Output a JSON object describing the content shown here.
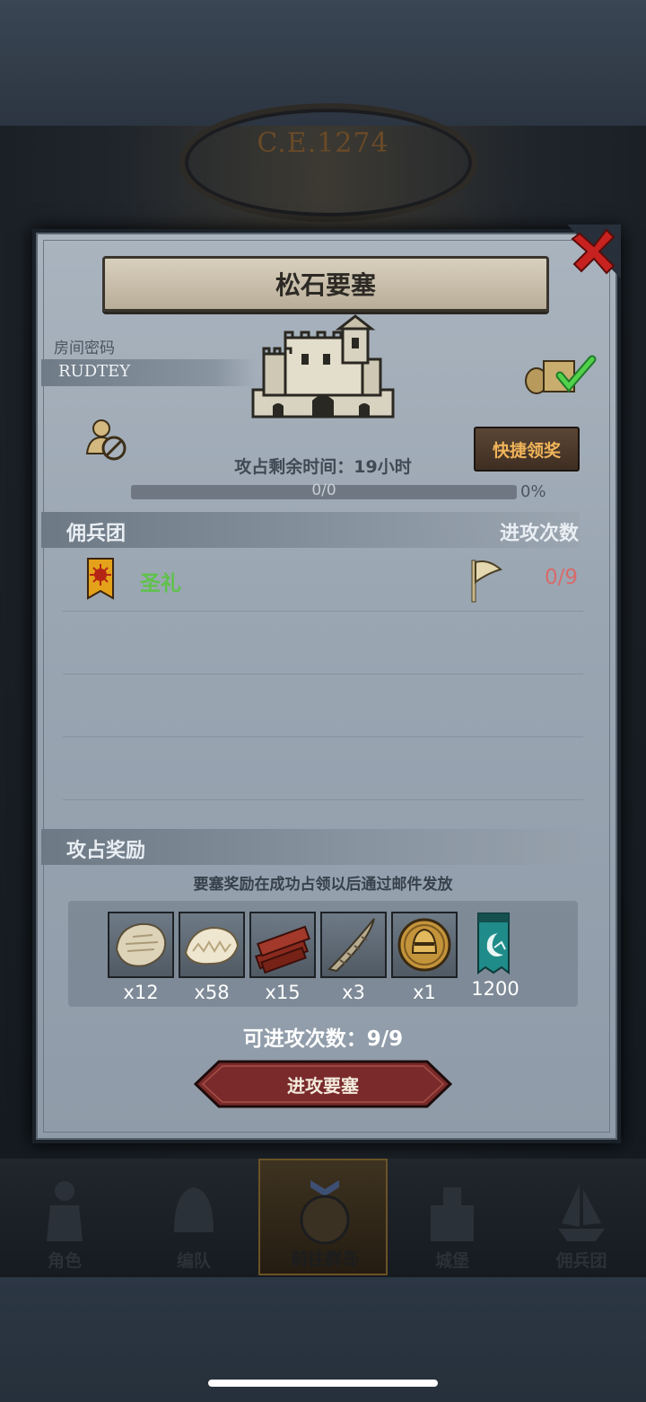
{
  "background": {
    "year_label": "C.E.1274"
  },
  "panel": {
    "title": "松石要塞",
    "room_label": "房间密码",
    "room_code": "RUDTEY",
    "quick_claim_label": "快捷领奖",
    "remaining_time_label": "攻占剩余时间：",
    "remaining_time_value": "19小时",
    "progress_text": "0/0",
    "progress_percent_label": "0%",
    "progress_fraction": 0
  },
  "mercenary_section": {
    "header_left": "佣兵团",
    "header_right": "进攻次数",
    "rows": [
      {
        "name": "圣礼",
        "attacks": "0/9"
      }
    ]
  },
  "rewards_section": {
    "header": "攻占奖励",
    "notice": "要塞奖励在成功占领以后通过邮件发放",
    "items": [
      {
        "icon": "fur-pelt-icon",
        "qty": "x12"
      },
      {
        "icon": "fluffy-pelt-icon",
        "qty": "x58"
      },
      {
        "icon": "wood-planks-icon",
        "qty": "x15"
      },
      {
        "icon": "horn-icon",
        "qty": "x3"
      },
      {
        "icon": "knight-helmet-coin-icon",
        "qty": "x1"
      },
      {
        "icon": "guild-banner-icon",
        "qty": "1200"
      }
    ]
  },
  "attempts": {
    "label": "可进攻次数：",
    "value": "9/9"
  },
  "attack_button": {
    "label": "进攻要塞"
  },
  "nav": {
    "items": [
      {
        "label": "角色"
      },
      {
        "label": "编队"
      },
      {
        "label": "前往群岛"
      },
      {
        "label": "城堡"
      },
      {
        "label": "佣兵团"
      }
    ],
    "active_index": 2
  },
  "colors": {
    "mercenary_name": "#5fc24b",
    "attack_count": "#d86a6a",
    "quick_button_text": "#f0b45a",
    "attack_button": "#7a2a2a"
  }
}
